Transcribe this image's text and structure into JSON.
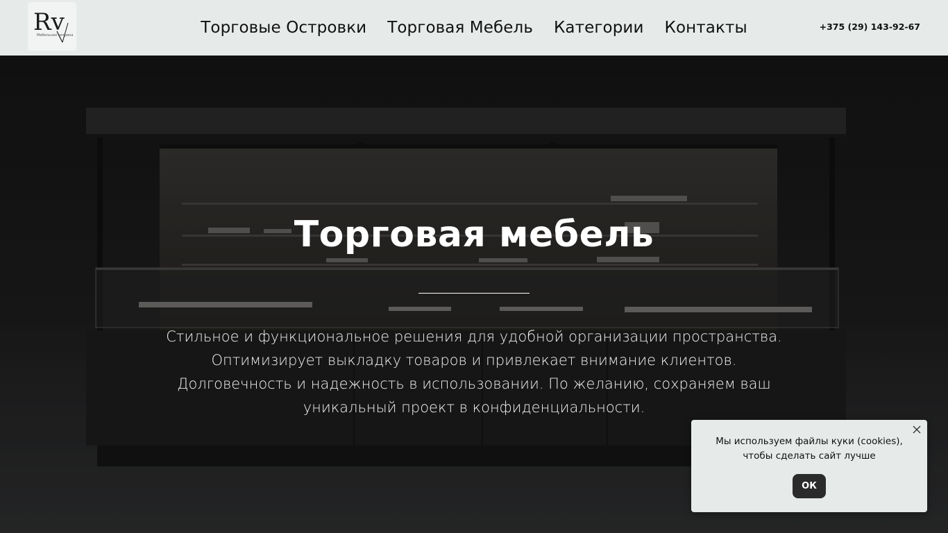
{
  "header": {
    "logo_text": "Rv",
    "logo_subtext": "Мебельная витрина",
    "nav": [
      {
        "label": "Торговые Островки"
      },
      {
        "label": "Торговая Мебель"
      },
      {
        "label": "Категории"
      },
      {
        "label": "Контакты"
      }
    ],
    "phone": "+375 (29) 143-92-67"
  },
  "hero": {
    "title": "Торговая мебель",
    "description_lines": [
      "Стильное и функциональное решения для удобной организации пространства.",
      "Оптимизирует выкладку товаров и привлекает внимание клиентов.",
      "Долговечность и надежность в использовании. По желанию, сохраняем ваш",
      "уникальный проект в конфиденциальности."
    ]
  },
  "cookie": {
    "text_lines": [
      "Мы используем файлы куки (cookies),",
      "чтобы сделать сайт лучше"
    ],
    "ok_label": "ОК",
    "close_icon": "close-icon"
  },
  "colors": {
    "header_bg": "#e6ebea",
    "text_dark": "#111111",
    "button_dark": "#2b2b2b",
    "hero_text": "#ffffff"
  }
}
